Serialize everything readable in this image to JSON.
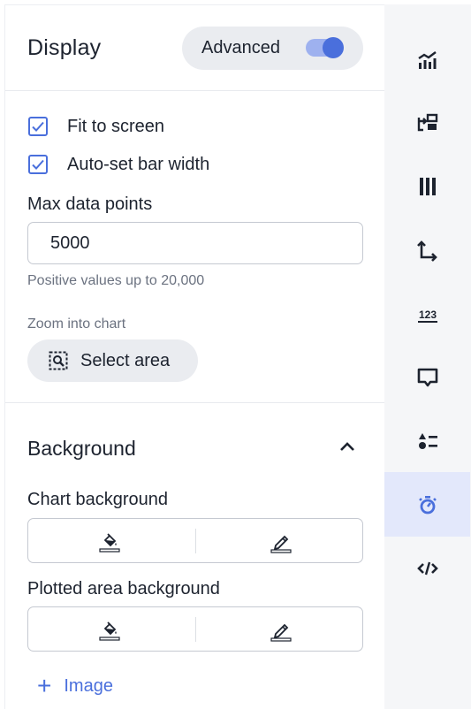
{
  "header": {
    "title": "Display",
    "advanced_label": "Advanced",
    "advanced_enabled": true
  },
  "display": {
    "fit_to_screen": {
      "label": "Fit to screen",
      "checked": true
    },
    "auto_bar_width": {
      "label": "Auto-set bar width",
      "checked": true
    },
    "max_points": {
      "label": "Max data points",
      "value": "5000",
      "hint": "Positive values up to 20,000"
    },
    "zoom": {
      "label": "Zoom into chart",
      "button_label": "Select area"
    }
  },
  "background": {
    "title": "Background",
    "expanded": true,
    "chart_background_label": "Chart background",
    "plotted_area_label": "Plotted area background",
    "add_image_label": "Image"
  },
  "rail": {
    "items": [
      {
        "icon": "chart-icon"
      },
      {
        "icon": "swap-layout-icon"
      },
      {
        "icon": "columns-icon"
      },
      {
        "icon": "axes-icon"
      },
      {
        "icon": "numbers-icon"
      },
      {
        "icon": "tooltip-icon"
      },
      {
        "icon": "legend-icon"
      },
      {
        "icon": "display-icon",
        "active": true
      },
      {
        "icon": "code-icon"
      }
    ]
  },
  "colors": {
    "accent": "#4a6fdc",
    "rail_active_bg": "#e3e8fb",
    "pill_bg": "#eaecf0",
    "text": "#1d232f",
    "hint": "#6b7280"
  }
}
